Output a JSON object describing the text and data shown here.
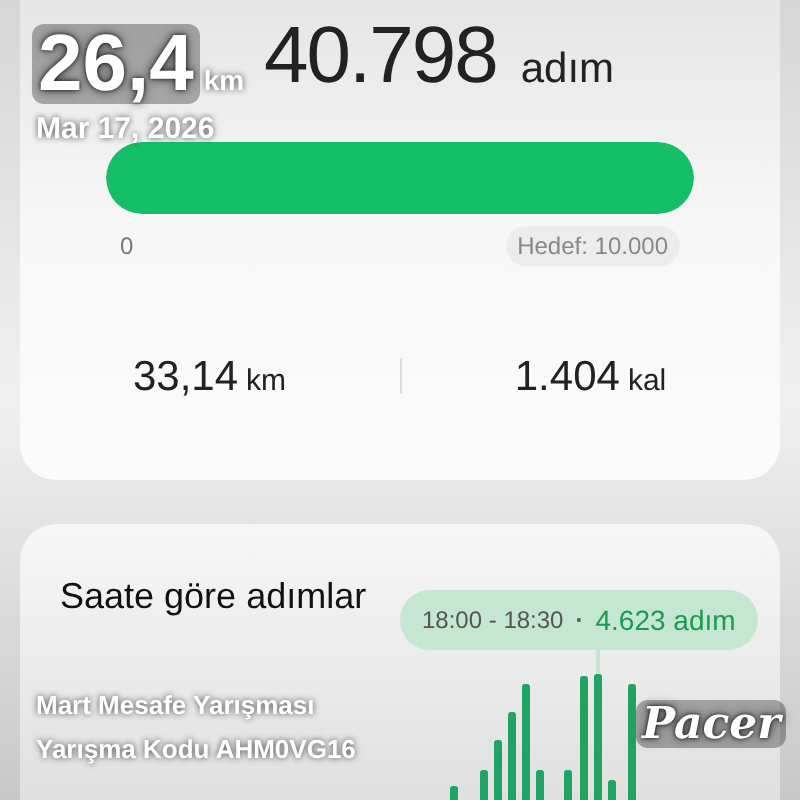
{
  "overlay": {
    "distance": "26,4",
    "distance_unit": "km",
    "date": "Mar 17, 2026",
    "challenge_name": "Mart Mesafe Yarışması",
    "challenge_code": "Yarışma Kodu AHM0VG16",
    "logo": "Pacer"
  },
  "steps": {
    "value": "40.798",
    "unit": "adım",
    "level": 1,
    "min_label": "0",
    "goal_label": "Hedef: 10.000"
  },
  "stats": [
    {
      "value": "33,14",
      "unit": "km"
    },
    {
      "value": "1.404",
      "unit": "kal"
    }
  ],
  "hourly": {
    "title": "Saate göre adımlar",
    "tooltip": {
      "time": "18:00 - 18:30",
      "separator": "·",
      "value": "4.623 adım"
    }
  }
}
